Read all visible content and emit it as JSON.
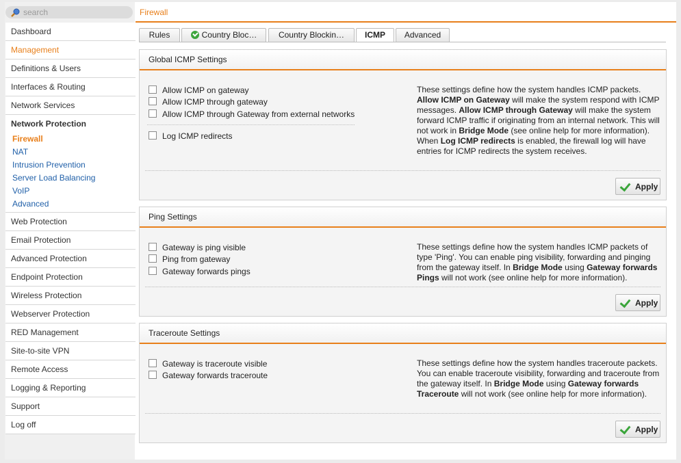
{
  "search": {
    "placeholder": "search"
  },
  "header": {
    "title": "Firewall"
  },
  "sidebar": {
    "top_items": [
      {
        "label": "Dashboard"
      },
      {
        "label": "Management"
      },
      {
        "label": "Definitions & Users"
      },
      {
        "label": "Interfaces & Routing"
      },
      {
        "label": "Network Services"
      }
    ],
    "group": {
      "title": "Network Protection",
      "items": [
        {
          "label": "Firewall"
        },
        {
          "label": "NAT"
        },
        {
          "label": "Intrusion Prevention"
        },
        {
          "label": "Server Load Balancing"
        },
        {
          "label": "VoIP"
        },
        {
          "label": "Advanced"
        }
      ]
    },
    "bottom_items": [
      {
        "label": "Web Protection"
      },
      {
        "label": "Email Protection"
      },
      {
        "label": "Advanced Protection"
      },
      {
        "label": "Endpoint Protection"
      },
      {
        "label": "Wireless Protection"
      },
      {
        "label": "Webserver Protection"
      },
      {
        "label": "RED Management"
      },
      {
        "label": "Site-to-site VPN"
      },
      {
        "label": "Remote Access"
      },
      {
        "label": "Logging & Reporting"
      },
      {
        "label": "Support"
      },
      {
        "label": "Log off"
      }
    ]
  },
  "tabs": [
    {
      "label": "Rules"
    },
    {
      "label": "Country Bloc…"
    },
    {
      "label": "Country Blockin…"
    },
    {
      "label": "ICMP"
    },
    {
      "label": "Advanced"
    }
  ],
  "global_icmp": {
    "title": "Global ICMP Settings",
    "options": [
      {
        "label": "Allow ICMP on gateway",
        "checked": false
      },
      {
        "label": "Allow ICMP through gateway",
        "checked": false
      },
      {
        "label": "Allow ICMP through Gateway from external networks",
        "checked": false
      },
      {
        "label": "Log ICMP redirects",
        "checked": false
      }
    ],
    "desc": {
      "t1": "These settings define how the system handles ICMP packets. ",
      "b1": "Allow ICMP on Gateway",
      "t2": " will make the system respond with ICMP messages. ",
      "b2": "Allow ICMP through Gateway",
      "t3": " will make the system forward ICMP traffic if originating from an internal network. This will not work in ",
      "b3": "Bridge Mode",
      "t4": " (see online help for more information). When ",
      "b4": "Log ICMP redirects",
      "t5": " is enabled, the firewall log will have entries for ICMP redirects the system receives."
    },
    "apply_label": "Apply"
  },
  "ping": {
    "title": "Ping Settings",
    "options": [
      {
        "label": "Gateway is ping visible",
        "checked": false
      },
      {
        "label": "Ping from gateway",
        "checked": false
      },
      {
        "label": "Gateway forwards pings",
        "checked": false
      }
    ],
    "desc": {
      "t1": "These settings define how the system handles ICMP packets of type 'Ping'. You can enable ping visibility, forwarding and pinging from the gateway itself. In ",
      "b1": "Bridge Mode",
      "t2": " using ",
      "b2": "Gateway forwards Pings",
      "t3": " will not work (see online help for more information)."
    },
    "apply_label": "Apply"
  },
  "traceroute": {
    "title": "Traceroute Settings",
    "options": [
      {
        "label": "Gateway is traceroute visible",
        "checked": false
      },
      {
        "label": "Gateway forwards traceroute",
        "checked": false
      }
    ],
    "desc": {
      "t1": "These settings define how the system handles traceroute packets. You can enable traceroute visibility, forwarding and traceroute from the gateway itself. In ",
      "b1": "Bridge Mode",
      "t2": " using ",
      "b2": "Gateway forwards Traceroute",
      "t3": " will not work (see online help for more information)."
    },
    "apply_label": "Apply"
  }
}
